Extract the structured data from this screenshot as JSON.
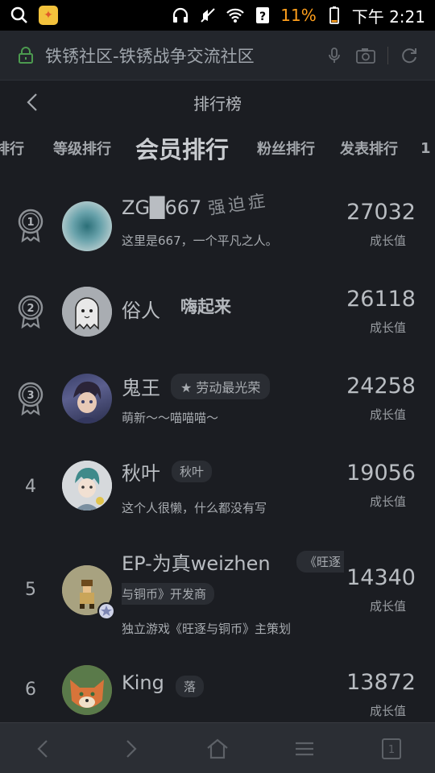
{
  "status": {
    "battery_pct": "11%",
    "time": "下午 2:21"
  },
  "address": {
    "title": "铁锈社区-铁锈战争交流社区"
  },
  "header": {
    "title": "排行榜"
  },
  "tabs": [
    {
      "label": "排行"
    },
    {
      "label": "等级排行"
    },
    {
      "label": "会员排行",
      "active": true
    },
    {
      "label": "粉丝排行"
    },
    {
      "label": "发表排行"
    },
    {
      "label": "1"
    }
  ],
  "rows": [
    {
      "rank": "1",
      "name": "ZG█667",
      "name_extra": "强迫症",
      "tags": [],
      "signature": "这里是667，一个平凡之人。",
      "score": "27032",
      "score_label": "成长值"
    },
    {
      "rank": "2",
      "name": "俗人",
      "name_extra": "嗨起来",
      "tags": [],
      "signature": "",
      "score": "26118",
      "score_label": "成长值"
    },
    {
      "rank": "3",
      "name": "鬼王",
      "tags": [
        "★ 劳动最光荣"
      ],
      "signature": "萌新～～喵喵喵～",
      "score": "24258",
      "score_label": "成长值"
    },
    {
      "rank": "4",
      "name": "秋叶",
      "tags": [
        "秋叶"
      ],
      "signature": "这个人很懒，什么都没有写",
      "score": "19056",
      "score_label": "成长值"
    },
    {
      "rank": "5",
      "name": "EP-为真weizhen",
      "tags": [
        "《旺逐",
        "与铜币》开发商"
      ],
      "signature": "独立游戏《旺逐与铜币》主策划",
      "score": "14340",
      "score_label": "成长值"
    },
    {
      "rank": "6",
      "name": "King",
      "tags": [
        "落"
      ],
      "signature": "",
      "score": "13872",
      "score_label": "成长值"
    }
  ]
}
